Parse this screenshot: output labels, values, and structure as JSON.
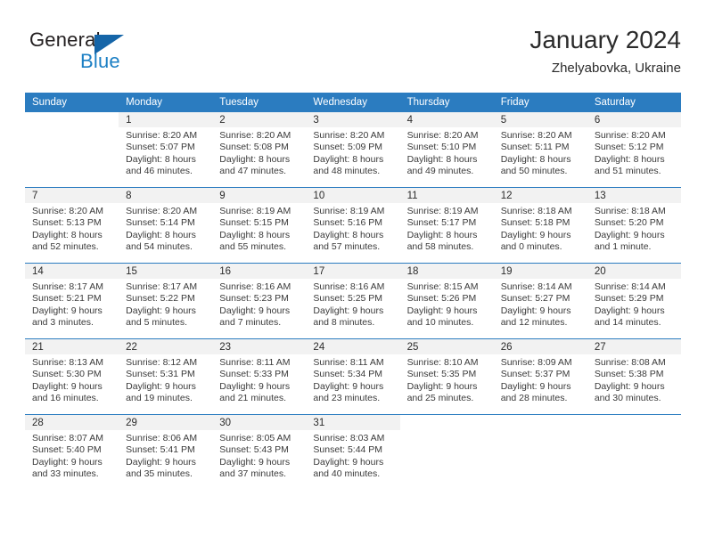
{
  "brand": {
    "line1": "General",
    "line2": "Blue",
    "flag_icon": "triangle-flag-icon",
    "colors": {
      "general": "#231f20",
      "blue": "#1b7fc4",
      "flag": "#1565a8"
    }
  },
  "header": {
    "title": "January 2024",
    "location": "Zhelyabovka, Ukraine"
  },
  "theme": {
    "header_bg": "#2b7cc0",
    "header_text": "#ffffff",
    "daynum_band_bg": "#f2f2f2",
    "row_divider": "#2b7cc0",
    "body_text": "#3a3a3a"
  },
  "weekday_headers": [
    "Sunday",
    "Monday",
    "Tuesday",
    "Wednesday",
    "Thursday",
    "Friday",
    "Saturday"
  ],
  "labels": {
    "sunrise_prefix": "Sunrise:",
    "sunset_prefix": "Sunset:",
    "daylight_prefix": "Daylight:"
  },
  "weeks": [
    [
      {
        "day": "",
        "blank": true,
        "sunrise": "",
        "sunset": "",
        "daylight_line1": "",
        "daylight_line2": ""
      },
      {
        "day": "1",
        "sunrise": "Sunrise: 8:20 AM",
        "sunset": "Sunset: 5:07 PM",
        "daylight_line1": "Daylight: 8 hours",
        "daylight_line2": "and 46 minutes."
      },
      {
        "day": "2",
        "sunrise": "Sunrise: 8:20 AM",
        "sunset": "Sunset: 5:08 PM",
        "daylight_line1": "Daylight: 8 hours",
        "daylight_line2": "and 47 minutes."
      },
      {
        "day": "3",
        "sunrise": "Sunrise: 8:20 AM",
        "sunset": "Sunset: 5:09 PM",
        "daylight_line1": "Daylight: 8 hours",
        "daylight_line2": "and 48 minutes."
      },
      {
        "day": "4",
        "sunrise": "Sunrise: 8:20 AM",
        "sunset": "Sunset: 5:10 PM",
        "daylight_line1": "Daylight: 8 hours",
        "daylight_line2": "and 49 minutes."
      },
      {
        "day": "5",
        "sunrise": "Sunrise: 8:20 AM",
        "sunset": "Sunset: 5:11 PM",
        "daylight_line1": "Daylight: 8 hours",
        "daylight_line2": "and 50 minutes."
      },
      {
        "day": "6",
        "sunrise": "Sunrise: 8:20 AM",
        "sunset": "Sunset: 5:12 PM",
        "daylight_line1": "Daylight: 8 hours",
        "daylight_line2": "and 51 minutes."
      }
    ],
    [
      {
        "day": "7",
        "sunrise": "Sunrise: 8:20 AM",
        "sunset": "Sunset: 5:13 PM",
        "daylight_line1": "Daylight: 8 hours",
        "daylight_line2": "and 52 minutes."
      },
      {
        "day": "8",
        "sunrise": "Sunrise: 8:20 AM",
        "sunset": "Sunset: 5:14 PM",
        "daylight_line1": "Daylight: 8 hours",
        "daylight_line2": "and 54 minutes."
      },
      {
        "day": "9",
        "sunrise": "Sunrise: 8:19 AM",
        "sunset": "Sunset: 5:15 PM",
        "daylight_line1": "Daylight: 8 hours",
        "daylight_line2": "and 55 minutes."
      },
      {
        "day": "10",
        "sunrise": "Sunrise: 8:19 AM",
        "sunset": "Sunset: 5:16 PM",
        "daylight_line1": "Daylight: 8 hours",
        "daylight_line2": "and 57 minutes."
      },
      {
        "day": "11",
        "sunrise": "Sunrise: 8:19 AM",
        "sunset": "Sunset: 5:17 PM",
        "daylight_line1": "Daylight: 8 hours",
        "daylight_line2": "and 58 minutes."
      },
      {
        "day": "12",
        "sunrise": "Sunrise: 8:18 AM",
        "sunset": "Sunset: 5:18 PM",
        "daylight_line1": "Daylight: 9 hours",
        "daylight_line2": "and 0 minutes."
      },
      {
        "day": "13",
        "sunrise": "Sunrise: 8:18 AM",
        "sunset": "Sunset: 5:20 PM",
        "daylight_line1": "Daylight: 9 hours",
        "daylight_line2": "and 1 minute."
      }
    ],
    [
      {
        "day": "14",
        "sunrise": "Sunrise: 8:17 AM",
        "sunset": "Sunset: 5:21 PM",
        "daylight_line1": "Daylight: 9 hours",
        "daylight_line2": "and 3 minutes."
      },
      {
        "day": "15",
        "sunrise": "Sunrise: 8:17 AM",
        "sunset": "Sunset: 5:22 PM",
        "daylight_line1": "Daylight: 9 hours",
        "daylight_line2": "and 5 minutes."
      },
      {
        "day": "16",
        "sunrise": "Sunrise: 8:16 AM",
        "sunset": "Sunset: 5:23 PM",
        "daylight_line1": "Daylight: 9 hours",
        "daylight_line2": "and 7 minutes."
      },
      {
        "day": "17",
        "sunrise": "Sunrise: 8:16 AM",
        "sunset": "Sunset: 5:25 PM",
        "daylight_line1": "Daylight: 9 hours",
        "daylight_line2": "and 8 minutes."
      },
      {
        "day": "18",
        "sunrise": "Sunrise: 8:15 AM",
        "sunset": "Sunset: 5:26 PM",
        "daylight_line1": "Daylight: 9 hours",
        "daylight_line2": "and 10 minutes."
      },
      {
        "day": "19",
        "sunrise": "Sunrise: 8:14 AM",
        "sunset": "Sunset: 5:27 PM",
        "daylight_line1": "Daylight: 9 hours",
        "daylight_line2": "and 12 minutes."
      },
      {
        "day": "20",
        "sunrise": "Sunrise: 8:14 AM",
        "sunset": "Sunset: 5:29 PM",
        "daylight_line1": "Daylight: 9 hours",
        "daylight_line2": "and 14 minutes."
      }
    ],
    [
      {
        "day": "21",
        "sunrise": "Sunrise: 8:13 AM",
        "sunset": "Sunset: 5:30 PM",
        "daylight_line1": "Daylight: 9 hours",
        "daylight_line2": "and 16 minutes."
      },
      {
        "day": "22",
        "sunrise": "Sunrise: 8:12 AM",
        "sunset": "Sunset: 5:31 PM",
        "daylight_line1": "Daylight: 9 hours",
        "daylight_line2": "and 19 minutes."
      },
      {
        "day": "23",
        "sunrise": "Sunrise: 8:11 AM",
        "sunset": "Sunset: 5:33 PM",
        "daylight_line1": "Daylight: 9 hours",
        "daylight_line2": "and 21 minutes."
      },
      {
        "day": "24",
        "sunrise": "Sunrise: 8:11 AM",
        "sunset": "Sunset: 5:34 PM",
        "daylight_line1": "Daylight: 9 hours",
        "daylight_line2": "and 23 minutes."
      },
      {
        "day": "25",
        "sunrise": "Sunrise: 8:10 AM",
        "sunset": "Sunset: 5:35 PM",
        "daylight_line1": "Daylight: 9 hours",
        "daylight_line2": "and 25 minutes."
      },
      {
        "day": "26",
        "sunrise": "Sunrise: 8:09 AM",
        "sunset": "Sunset: 5:37 PM",
        "daylight_line1": "Daylight: 9 hours",
        "daylight_line2": "and 28 minutes."
      },
      {
        "day": "27",
        "sunrise": "Sunrise: 8:08 AM",
        "sunset": "Sunset: 5:38 PM",
        "daylight_line1": "Daylight: 9 hours",
        "daylight_line2": "and 30 minutes."
      }
    ],
    [
      {
        "day": "28",
        "sunrise": "Sunrise: 8:07 AM",
        "sunset": "Sunset: 5:40 PM",
        "daylight_line1": "Daylight: 9 hours",
        "daylight_line2": "and 33 minutes."
      },
      {
        "day": "29",
        "sunrise": "Sunrise: 8:06 AM",
        "sunset": "Sunset: 5:41 PM",
        "daylight_line1": "Daylight: 9 hours",
        "daylight_line2": "and 35 minutes."
      },
      {
        "day": "30",
        "sunrise": "Sunrise: 8:05 AM",
        "sunset": "Sunset: 5:43 PM",
        "daylight_line1": "Daylight: 9 hours",
        "daylight_line2": "and 37 minutes."
      },
      {
        "day": "31",
        "sunrise": "Sunrise: 8:03 AM",
        "sunset": "Sunset: 5:44 PM",
        "daylight_line1": "Daylight: 9 hours",
        "daylight_line2": "and 40 minutes."
      },
      {
        "day": "",
        "blank": true,
        "sunrise": "",
        "sunset": "",
        "daylight_line1": "",
        "daylight_line2": ""
      },
      {
        "day": "",
        "blank": true,
        "sunrise": "",
        "sunset": "",
        "daylight_line1": "",
        "daylight_line2": ""
      },
      {
        "day": "",
        "blank": true,
        "sunrise": "",
        "sunset": "",
        "daylight_line1": "",
        "daylight_line2": ""
      }
    ]
  ]
}
